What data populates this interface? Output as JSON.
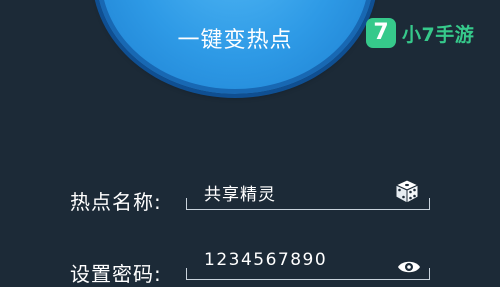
{
  "hotspot": {
    "button_label": "一键变热点"
  },
  "watermark": {
    "badge": "7",
    "text": "小7手游"
  },
  "form": {
    "name_label": "热点名称:",
    "name_value": "共享精灵",
    "password_label": "设置密码:",
    "password_value": "1234567890"
  },
  "icons": {
    "random_name": "dice-icon",
    "show_password": "eye-icon"
  },
  "colors": {
    "background": "#1c2a37",
    "hotspot_blue": "#2e9ae6",
    "watermark_green": "#36c98b"
  }
}
